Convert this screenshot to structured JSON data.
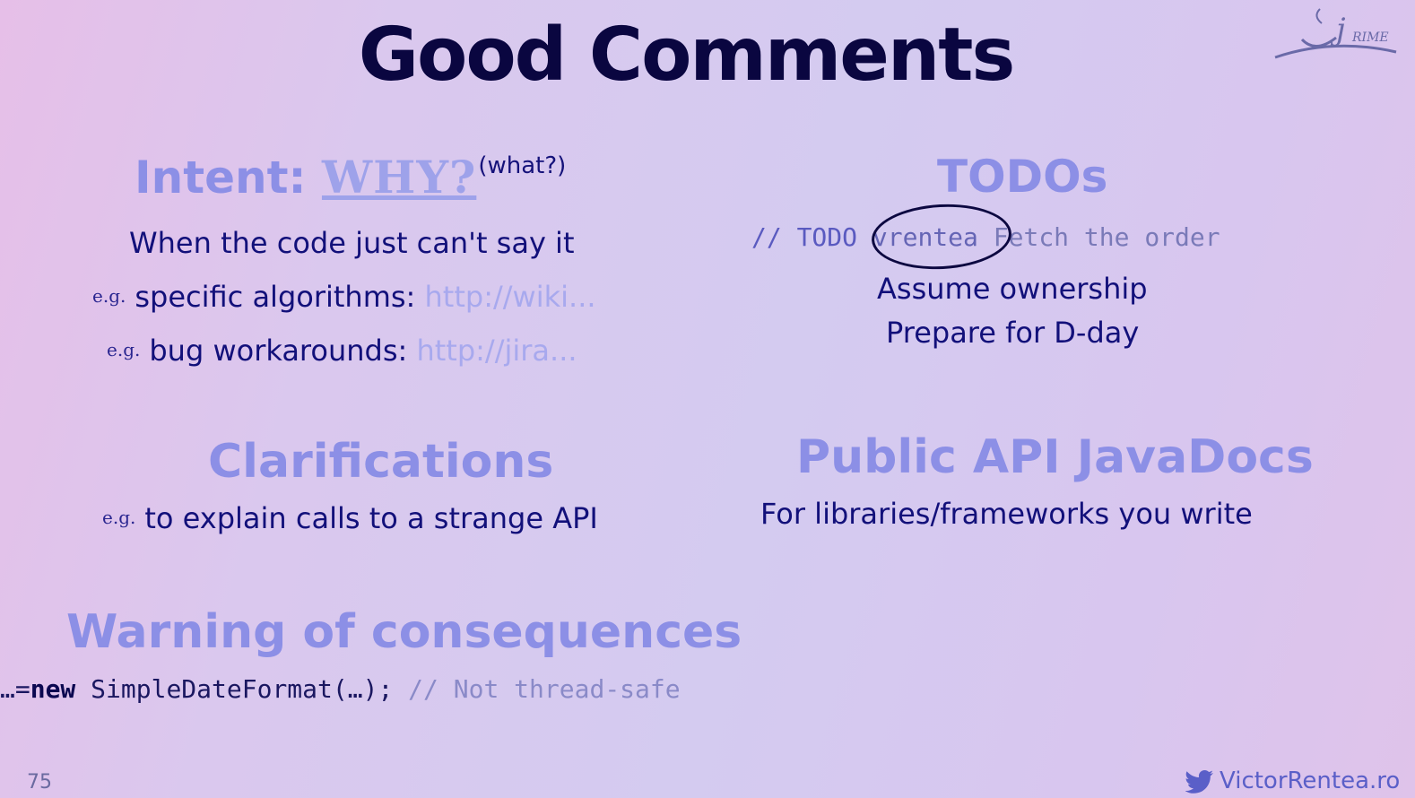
{
  "slide": {
    "title": "Good Comments",
    "page_number": "75",
    "footer_text": "VictorRentea.ro",
    "logo_text": "j RIME"
  },
  "intent": {
    "heading_prefix": "Intent:",
    "heading_why": "WHY?",
    "heading_what": "(what?)",
    "line1": "When the code just can't say it",
    "line2_eg": "e.g.",
    "line2_text": "specific algorithms:",
    "line2_link": "http://wiki...",
    "line3_eg": "e.g.",
    "line3_text": "bug workarounds:",
    "line3_link": "http://jira..."
  },
  "todos": {
    "heading": "TODOs",
    "code_prefix": "// TODO",
    "code_owner": "vrentea",
    "code_suffix": "Fetch the order",
    "line1": "Assume ownership",
    "line2": "Prepare for D-day"
  },
  "clarifications": {
    "heading": "Clarifications",
    "eg": "e.g.",
    "text": "to explain calls to a strange API"
  },
  "public_api": {
    "heading": "Public API JavaDocs",
    "text": "For libraries/frameworks you write"
  },
  "warning": {
    "heading": "Warning of consequences",
    "code_prefix": "…=",
    "code_keyword": "new",
    "code_rest": " SimpleDateFormat(…); ",
    "code_comment": "// Not thread-safe"
  },
  "colors": {
    "title": "#0a0640",
    "heading": "#8c8fe6",
    "body": "#12107a",
    "link": "#a8a9ee"
  }
}
